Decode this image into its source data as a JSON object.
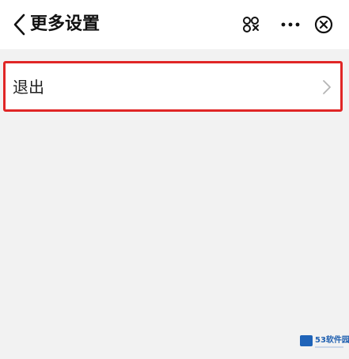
{
  "header": {
    "title": "更多设置",
    "back_icon": "chevron-left-icon",
    "scan_icon": "scan-icon",
    "more_icon": "more-dots-icon",
    "close_icon": "close-circle-icon"
  },
  "menu": {
    "items": [
      {
        "label": "退出",
        "icon": "chevron-right-icon"
      }
    ],
    "highlight_color": "#e02626"
  },
  "watermark": {
    "text": "53软件园"
  },
  "colors": {
    "background": "#f2f2f2",
    "surface": "#ffffff"
  }
}
